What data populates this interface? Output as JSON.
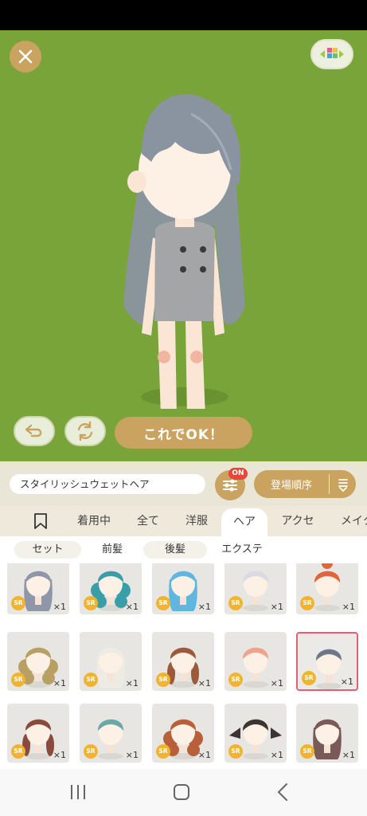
{
  "top_controls": {
    "close_icon": "close-icon",
    "layout_icon": "color-palette-icon"
  },
  "preview_controls": {
    "undo_icon": "undo-arrow-icon",
    "reset_icon": "refresh-cycle-icon",
    "ok_label": "これでOK！"
  },
  "colors": {
    "stage_bg": "#79a43a",
    "accent": "#c9a35f",
    "badge": "#e8463b",
    "rarity": "#f2b333",
    "selected_border": "#e0607a"
  },
  "name_bar": {
    "item_name": "スタイリッシュウェットヘア",
    "filter_badge": "ON",
    "sort_label": "登場順序"
  },
  "tabs": [
    {
      "label": "着用中"
    },
    {
      "label": "全て"
    },
    {
      "label": "洋服"
    },
    {
      "label": "ヘア",
      "active": true
    },
    {
      "label": "アクセ"
    },
    {
      "label": "メイク"
    }
  ],
  "subtabs": [
    {
      "label": "セット"
    },
    {
      "label": "前髪"
    },
    {
      "label": "後髪"
    },
    {
      "label": "エクステ"
    }
  ],
  "items": [
    {
      "rarity": "SR",
      "count": "×1",
      "hair": "#8e96a8",
      "style": "long"
    },
    {
      "rarity": "SR",
      "count": "×1",
      "hair": "#3a9ea8",
      "style": "curly"
    },
    {
      "rarity": "SR",
      "count": "×1",
      "hair": "#5fb7e0",
      "style": "long"
    },
    {
      "rarity": "SR",
      "count": "×1",
      "hair": "#d8dbe2",
      "style": "short"
    },
    {
      "rarity": "SR",
      "count": "×1",
      "hair": "#e0663a",
      "style": "bun"
    },
    {
      "rarity": "SR",
      "count": "×1",
      "hair": "#b8a065",
      "style": "curly"
    },
    {
      "rarity": "SR",
      "count": "×1",
      "hair": "#eeeae4",
      "style": "long"
    },
    {
      "rarity": "SR",
      "count": "×1",
      "hair": "#9b5a3a",
      "style": "braid"
    },
    {
      "rarity": "SR",
      "count": "×1",
      "hair": "#f0a28c",
      "style": "short"
    },
    {
      "rarity": "SR",
      "count": "×1",
      "hair": "#6f7888",
      "style": "short",
      "selected": true
    },
    {
      "rarity": "SR",
      "count": "×1",
      "hair": "#8b4a3e",
      "style": "braid"
    },
    {
      "rarity": "SR",
      "count": "×1",
      "hair": "#6aa7a8",
      "style": "short"
    },
    {
      "rarity": "SR",
      "count": "×1",
      "hair": "#b8603a",
      "style": "curly"
    },
    {
      "rarity": "SR",
      "count": "×1",
      "hair": "#3c3434",
      "style": "twin"
    },
    {
      "rarity": "SR",
      "count": "×1",
      "hair": "#7a5a58",
      "style": "long"
    }
  ],
  "nav": {
    "recent_icon": "recent-apps-icon",
    "home_icon": "home-icon",
    "back_icon": "back-icon"
  }
}
